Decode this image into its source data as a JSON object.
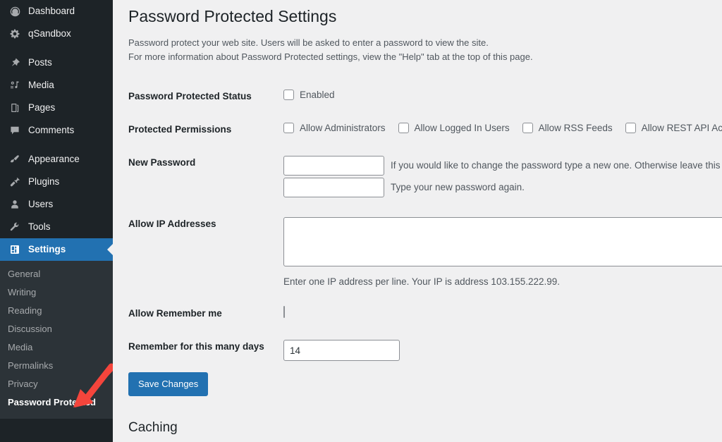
{
  "sidebar": {
    "items": [
      {
        "label": "Dashboard",
        "icon": "dashboard-gauge-icon"
      },
      {
        "label": "qSandbox",
        "icon": "gear-icon"
      },
      {
        "label": "Posts",
        "icon": "pin-icon"
      },
      {
        "label": "Media",
        "icon": "media-icon"
      },
      {
        "label": "Pages",
        "icon": "pages-icon"
      },
      {
        "label": "Comments",
        "icon": "comment-bubble-icon"
      },
      {
        "label": "Appearance",
        "icon": "paintbrush-icon"
      },
      {
        "label": "Plugins",
        "icon": "plug-icon"
      },
      {
        "label": "Users",
        "icon": "user-icon"
      },
      {
        "label": "Tools",
        "icon": "wrench-icon"
      },
      {
        "label": "Settings",
        "icon": "settings-sliders-icon"
      }
    ],
    "active_item": "Settings",
    "submenu": [
      {
        "label": "General"
      },
      {
        "label": "Writing"
      },
      {
        "label": "Reading"
      },
      {
        "label": "Discussion"
      },
      {
        "label": "Media"
      },
      {
        "label": "Permalinks"
      },
      {
        "label": "Privacy"
      },
      {
        "label": "Password Protected"
      }
    ],
    "current_submenu": "Password Protected",
    "annotation": {
      "name": "red-arrow-pointing-to-password-protected",
      "color": "#f4453c"
    }
  },
  "main": {
    "title": "Password Protected Settings",
    "description_line1": "Password protect your web site. Users will be asked to enter a password to view the site.",
    "description_line2": "For more information about Password Protected settings, view the \"Help\" tab at the top of this page.",
    "rows": {
      "status": {
        "label": "Password Protected Status",
        "checkbox_label": "Enabled",
        "checked": false
      },
      "permissions": {
        "label": "Protected Permissions",
        "options": [
          {
            "label": "Allow Administrators",
            "checked": false
          },
          {
            "label": "Allow Logged In Users",
            "checked": false
          },
          {
            "label": "Allow RSS Feeds",
            "checked": false
          },
          {
            "label": "Allow REST API Access",
            "checked": false
          }
        ]
      },
      "new_password": {
        "label": "New Password",
        "password_value": "",
        "password_placeholder": "",
        "password_help": "If you would like to change the password type a new one. Otherwise leave this blank.",
        "confirm_value": "",
        "confirm_placeholder": "",
        "confirm_help": "Type your new password again."
      },
      "allow_ip": {
        "label": "Allow IP Addresses",
        "value": "",
        "placeholder": "",
        "help": "Enter one IP address per line. Your IP is address 103.155.222.99."
      },
      "remember_me": {
        "label": "Allow Remember me",
        "checked": false
      },
      "remember_days": {
        "label": "Remember for this many days",
        "value": "14"
      }
    },
    "save_label": "Save Changes",
    "caching_heading": "Caching"
  },
  "colors": {
    "accent": "#2271b1",
    "sidebar_bg": "#1d2327",
    "submenu_bg": "#2c3338",
    "page_bg": "#f0f0f1",
    "annotation_red": "#f4453c"
  }
}
